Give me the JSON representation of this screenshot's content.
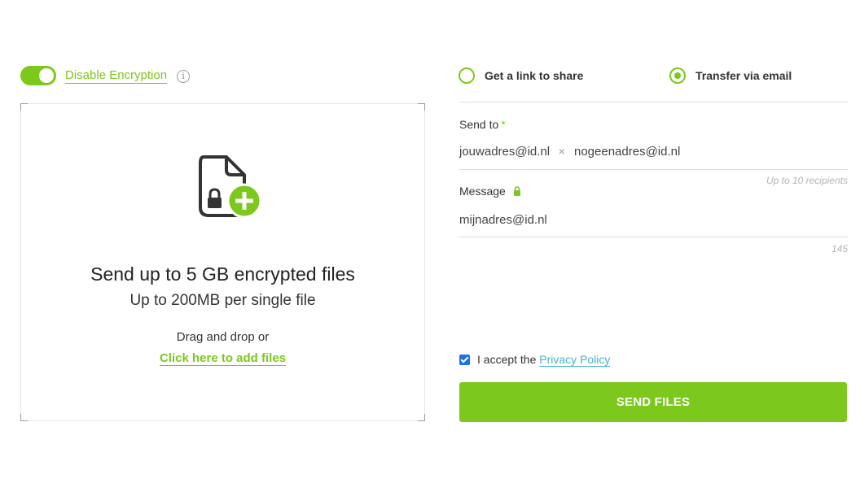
{
  "encryption": {
    "toggle_on": true,
    "label": "Disable Encryption",
    "info_icon": "info-icon"
  },
  "dropzone": {
    "icon": "locked-file-add-icon",
    "title": "Send up to 5 GB encrypted files",
    "subtitle": "Up to 200MB per single file",
    "drag_text": "Drag and drop or",
    "click_text": "Click here to add files"
  },
  "mode": {
    "options": [
      {
        "label": "Get a link to share",
        "selected": false
      },
      {
        "label": "Transfer via email",
        "selected": true
      }
    ]
  },
  "send_to": {
    "label": "Send to",
    "required_mark": "*",
    "recipients": [
      {
        "email": "jouwadres@id.nl",
        "remove": "×"
      },
      {
        "email": "nogeenadres@id.nl"
      }
    ],
    "hint": "Up to 10 recipients"
  },
  "message": {
    "label": "Message",
    "value": "mijnadres@id.nl",
    "char_count": "145"
  },
  "privacy": {
    "checked": true,
    "text": "I accept the",
    "link": "Privacy Policy"
  },
  "send_button": "SEND FILES",
  "colors": {
    "accent": "#7dc81d",
    "link": "#46b5c8",
    "checkbox": "#1a73e8"
  }
}
